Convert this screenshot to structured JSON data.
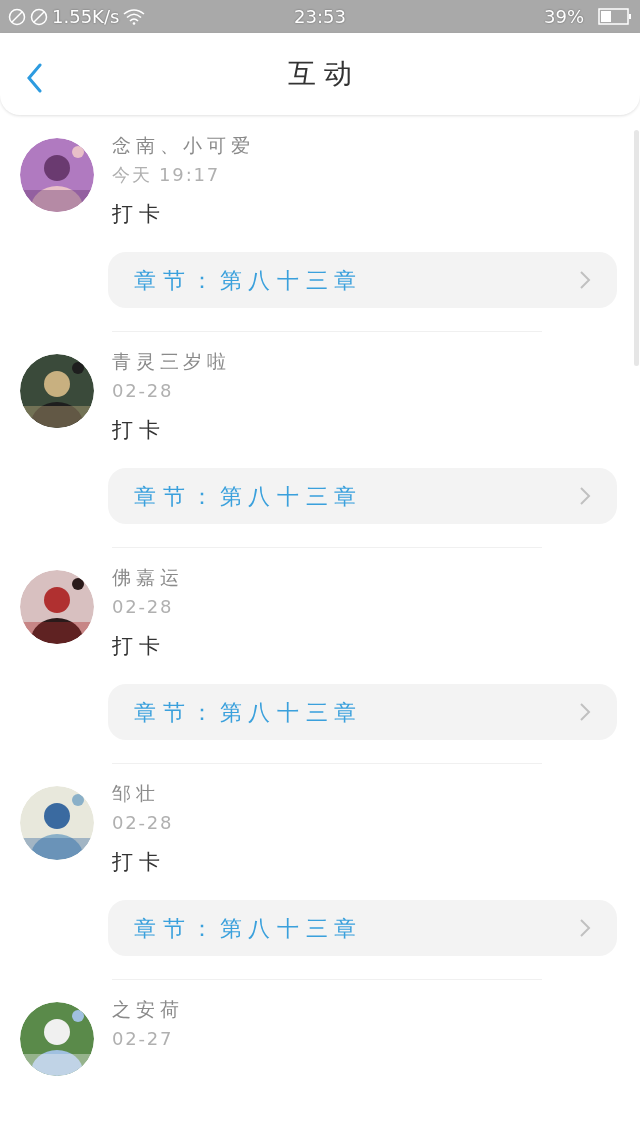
{
  "status_bar": {
    "speed": "1.55K/s",
    "time": "23:53",
    "battery": "39%"
  },
  "header": {
    "title": "互动"
  },
  "items": [
    {
      "name": "念南、小可爱",
      "date": "今天 19:17",
      "text": "打卡",
      "chapter": "章节：第八十三章"
    },
    {
      "name": "青灵三岁啦",
      "date": "02-28",
      "text": "打卡",
      "chapter": "章节：第八十三章"
    },
    {
      "name": "佛嘉运",
      "date": "02-28",
      "text": "打卡",
      "chapter": "章节：第八十三章"
    },
    {
      "name": "邹壮",
      "date": "02-28",
      "text": "打卡",
      "chapter": "章节：第八十三章"
    },
    {
      "name": "之安荷",
      "date": "02-27"
    }
  ]
}
